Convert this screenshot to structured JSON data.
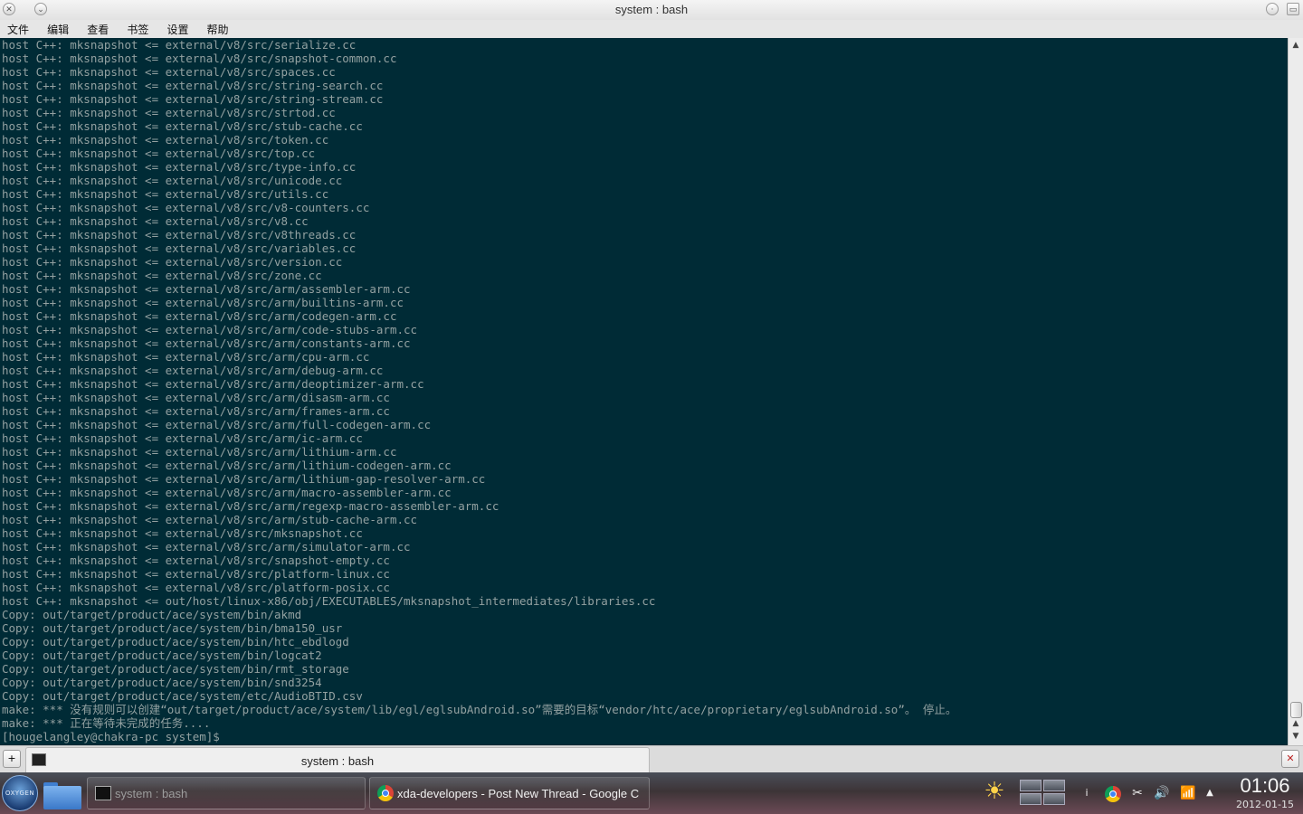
{
  "window": {
    "title": "system : bash"
  },
  "menu": [
    "文件",
    "编辑",
    "查看",
    "书签",
    "设置",
    "帮助"
  ],
  "terminal": {
    "lines": [
      "host C++: mksnapshot <= external/v8/src/serialize.cc",
      "host C++: mksnapshot <= external/v8/src/snapshot-common.cc",
      "host C++: mksnapshot <= external/v8/src/spaces.cc",
      "host C++: mksnapshot <= external/v8/src/string-search.cc",
      "host C++: mksnapshot <= external/v8/src/string-stream.cc",
      "host C++: mksnapshot <= external/v8/src/strtod.cc",
      "host C++: mksnapshot <= external/v8/src/stub-cache.cc",
      "host C++: mksnapshot <= external/v8/src/token.cc",
      "host C++: mksnapshot <= external/v8/src/top.cc",
      "host C++: mksnapshot <= external/v8/src/type-info.cc",
      "host C++: mksnapshot <= external/v8/src/unicode.cc",
      "host C++: mksnapshot <= external/v8/src/utils.cc",
      "host C++: mksnapshot <= external/v8/src/v8-counters.cc",
      "host C++: mksnapshot <= external/v8/src/v8.cc",
      "host C++: mksnapshot <= external/v8/src/v8threads.cc",
      "host C++: mksnapshot <= external/v8/src/variables.cc",
      "host C++: mksnapshot <= external/v8/src/version.cc",
      "host C++: mksnapshot <= external/v8/src/zone.cc",
      "host C++: mksnapshot <= external/v8/src/arm/assembler-arm.cc",
      "host C++: mksnapshot <= external/v8/src/arm/builtins-arm.cc",
      "host C++: mksnapshot <= external/v8/src/arm/codegen-arm.cc",
      "host C++: mksnapshot <= external/v8/src/arm/code-stubs-arm.cc",
      "host C++: mksnapshot <= external/v8/src/arm/constants-arm.cc",
      "host C++: mksnapshot <= external/v8/src/arm/cpu-arm.cc",
      "host C++: mksnapshot <= external/v8/src/arm/debug-arm.cc",
      "host C++: mksnapshot <= external/v8/src/arm/deoptimizer-arm.cc",
      "host C++: mksnapshot <= external/v8/src/arm/disasm-arm.cc",
      "host C++: mksnapshot <= external/v8/src/arm/frames-arm.cc",
      "host C++: mksnapshot <= external/v8/src/arm/full-codegen-arm.cc",
      "host C++: mksnapshot <= external/v8/src/arm/ic-arm.cc",
      "host C++: mksnapshot <= external/v8/src/arm/lithium-arm.cc",
      "host C++: mksnapshot <= external/v8/src/arm/lithium-codegen-arm.cc",
      "host C++: mksnapshot <= external/v8/src/arm/lithium-gap-resolver-arm.cc",
      "host C++: mksnapshot <= external/v8/src/arm/macro-assembler-arm.cc",
      "host C++: mksnapshot <= external/v8/src/arm/regexp-macro-assembler-arm.cc",
      "host C++: mksnapshot <= external/v8/src/arm/stub-cache-arm.cc",
      "host C++: mksnapshot <= external/v8/src/mksnapshot.cc",
      "host C++: mksnapshot <= external/v8/src/arm/simulator-arm.cc",
      "host C++: mksnapshot <= external/v8/src/snapshot-empty.cc",
      "host C++: mksnapshot <= external/v8/src/platform-linux.cc",
      "host C++: mksnapshot <= external/v8/src/platform-posix.cc",
      "host C++: mksnapshot <= out/host/linux-x86/obj/EXECUTABLES/mksnapshot_intermediates/libraries.cc",
      "Copy: out/target/product/ace/system/bin/akmd",
      "Copy: out/target/product/ace/system/bin/bma150_usr",
      "Copy: out/target/product/ace/system/bin/htc_ebdlogd",
      "Copy: out/target/product/ace/system/bin/logcat2",
      "Copy: out/target/product/ace/system/bin/rmt_storage",
      "Copy: out/target/product/ace/system/bin/snd3254",
      "Copy: out/target/product/ace/system/etc/AudioBTID.csv",
      "make: *** 没有规则可以创建“out/target/product/ace/system/lib/egl/eglsubAndroid.so”需要的目标“vendor/htc/ace/proprietary/eglsubAndroid.so”。 停止。",
      "make: *** 正在等待未完成的任务....",
      "[hougelangley@chakra-pc system]$ "
    ]
  },
  "tabbar": {
    "tab_label": "system : bash"
  },
  "taskbar": {
    "launcher_label": "OXYGEN",
    "tasks": [
      {
        "label": "system : bash"
      },
      {
        "label": "xda-developers - Post New Thread - Google C"
      }
    ],
    "tray": {
      "info_label": "i"
    },
    "clock": {
      "time": "01:06",
      "date": "2012-01-15"
    }
  },
  "colors": {
    "terminal_bg": "#002b36",
    "terminal_fg": "#93a1a1",
    "accent": "#3a78c8"
  },
  "icons": [
    "close-icon",
    "menu-icon",
    "restore-icon",
    "maximize-icon",
    "new-tab-icon",
    "terminal-icon",
    "close-tab-icon",
    "kickoff-icon",
    "folder-icon",
    "chrome-icon",
    "weather-icon",
    "info-icon",
    "cut-icon",
    "volume-icon",
    "wifi-icon",
    "tray-expand-icon"
  ]
}
